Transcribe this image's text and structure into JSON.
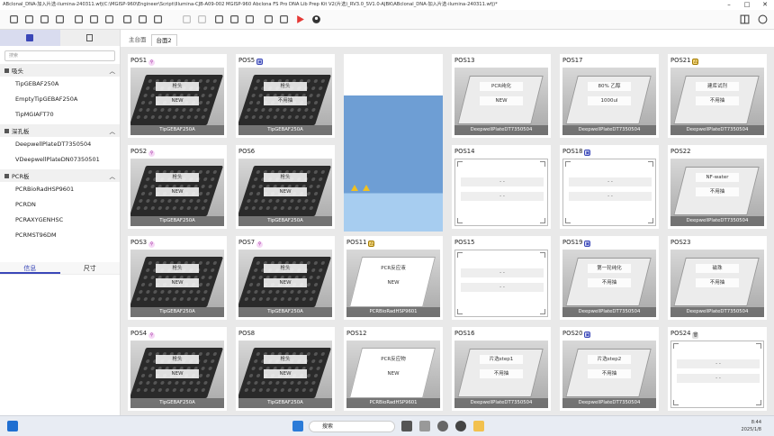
{
  "window": {
    "title": "ABclonal_DNA-加入片选-ilumina-240311.wfj(C:\\MGISP-960\\Engineer\\Script\\Illumina-CJB-A09-002 MGISP-960 Abclona FS Pro DNA Lib Prep Kit V2(片选)_RV3.0_SV1.0-AJBK\\ABclonal_DNA-加入片选-ilumina-240311.wfj)*"
  },
  "toolbar": {
    "icons": [
      "new-icon",
      "open-icon",
      "save-icon",
      "history-icon",
      "save-as-icon",
      "export-icon",
      "folder-icon",
      "print-icon",
      "print-preview-icon",
      "import-icon",
      "undo-icon",
      "redo-icon",
      "cut-icon",
      "copy-icon",
      "delete-icon",
      "target-icon",
      "settings-icon",
      "run-icon",
      "user-icon"
    ],
    "right_icons": [
      "panel-icon",
      "help-icon"
    ],
    "run_color": "#e53935"
  },
  "sidebar": {
    "search_placeholder": "搜索",
    "groups": [
      {
        "label": "吸头",
        "items": [
          "TipGEBAF250A",
          "EmptyTipGEBAF250A",
          "TipMGIAFT70"
        ]
      },
      {
        "label": "深孔板",
        "items": [
          "DeepwellPlateDT7350504",
          "VDeepwellPlateDN07350501"
        ]
      },
      {
        "label": "PCR板",
        "items": [
          "PCRBioRadHSP9601",
          "PCRDN",
          "PCRAXYGENHSC",
          "PCRMST96DM"
        ]
      }
    ],
    "info_tabs": [
      "信息",
      "尺寸"
    ]
  },
  "main_tabs": [
    "主台面",
    "台面2"
  ],
  "positions": [
    {
      "id": "POS1",
      "badge": "tip",
      "kind": "tip",
      "t1": "枪头",
      "t2": "NEW",
      "label": "TipGEBAF250A"
    },
    {
      "id": "POS2",
      "badge": "tip",
      "kind": "tip",
      "t1": "枪头",
      "t2": "NEW",
      "label": "TipGEBAF250A"
    },
    {
      "id": "POS3",
      "badge": "tip",
      "kind": "tip",
      "t1": "枪头",
      "t2": "NEW",
      "label": "TipGEBAF250A"
    },
    {
      "id": "POS4",
      "badge": "tip",
      "kind": "tip",
      "t1": "枪头",
      "t2": "NEW",
      "label": "TipGEBAF250A"
    },
    {
      "id": "POS5",
      "badge": "plate",
      "kind": "tip",
      "t1": "枪头",
      "t2": "不用抽",
      "label": "TipGEBAF250A"
    },
    {
      "id": "POS6",
      "badge": "",
      "kind": "tip",
      "t1": "枪头",
      "t2": "NEW",
      "label": "TipGEBAF250A"
    },
    {
      "id": "POS7",
      "badge": "tip",
      "kind": "tip",
      "t1": "枪头",
      "t2": "NEW",
      "label": "TipGEBAF250A"
    },
    {
      "id": "POS8",
      "badge": "",
      "kind": "tip",
      "t1": "枪头",
      "t2": "NEW",
      "label": "TipGEBAF250A"
    },
    {
      "id": "POS11",
      "badge": "warn",
      "kind": "pcr",
      "t1": "PCR反应液",
      "t2": "NEW",
      "label": "PCRBioRadHSP9601"
    },
    {
      "id": "POS12",
      "badge": "",
      "kind": "pcr",
      "t1": "PCR反应物",
      "t2": "NEW",
      "label": "PCRBioRadHSP9601"
    },
    {
      "id": "POS13",
      "badge": "",
      "kind": "deep",
      "t1": "PCR纯化",
      "t2": "NEW",
      "label": "DeepwellPlateDT7350504"
    },
    {
      "id": "POS14",
      "badge": "",
      "kind": "empty",
      "t1": "- -",
      "t2": "- -",
      "label": ""
    },
    {
      "id": "POS15",
      "badge": "",
      "kind": "empty",
      "t1": "- -",
      "t2": "- -",
      "label": ""
    },
    {
      "id": "POS16",
      "badge": "",
      "kind": "deep",
      "t1": "片选step1",
      "t2": "不用抽",
      "label": "DeepwellPlateDT7350504"
    },
    {
      "id": "POS17",
      "badge": "",
      "kind": "deep",
      "t1": "80% 乙醇",
      "t2": "1000ul",
      "label": "DeepwellPlateDT7350504"
    },
    {
      "id": "POS18",
      "badge": "plate",
      "kind": "empty",
      "t1": "- -",
      "t2": "- -",
      "label": ""
    },
    {
      "id": "POS19",
      "badge": "plate",
      "kind": "deep",
      "t1": "第一轮纯化",
      "t2": "不用抽",
      "label": "DeepwellPlateDT7350504"
    },
    {
      "id": "POS20",
      "badge": "plate",
      "kind": "deep",
      "t1": "片选step2",
      "t2": "不用抽",
      "label": "DeepwellPlateDT7350504"
    },
    {
      "id": "POS21",
      "badge": "warn",
      "kind": "deep",
      "t1": "建库试剂",
      "t2": "不用抽",
      "label": "DeepwellPlateDT7350504"
    },
    {
      "id": "POS22",
      "badge": "",
      "kind": "deep",
      "t1": "NF-water",
      "t2": "不用抽",
      "label": "DeepwellPlateDT7350504"
    },
    {
      "id": "POS23",
      "badge": "",
      "kind": "deep",
      "t1": "磁珠",
      "t2": "不用抽",
      "label": "DeepwellPlateDT7350504"
    },
    {
      "id": "POS24",
      "badge": "bin",
      "kind": "empty",
      "t1": "- -",
      "t2": "- -",
      "label": ""
    }
  ],
  "taskbar": {
    "search": "搜索",
    "time": "8:44",
    "date": "2025/1/8"
  }
}
